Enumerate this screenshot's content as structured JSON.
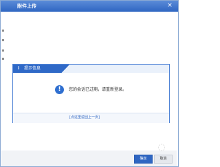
{
  "window": {
    "title": "附件上传",
    "close_glyph": "×"
  },
  "message_box": {
    "title": "提示信息",
    "info_glyph": "i",
    "alert_icon_glyph": "!",
    "message": "您的会话已过期，请重新登录。",
    "return_link": "[点这里返回上一页]"
  },
  "buttons": {
    "ok": "确定",
    "cancel": "取消"
  },
  "colors": {
    "accent": "#2f66c2",
    "title_bar": "#2f66c2",
    "panel_header": "#2f69c7",
    "panel_border": "#4f83d6"
  },
  "icons": {
    "close": "close-icon",
    "info": "info-icon",
    "alert": "exclamation-icon"
  }
}
